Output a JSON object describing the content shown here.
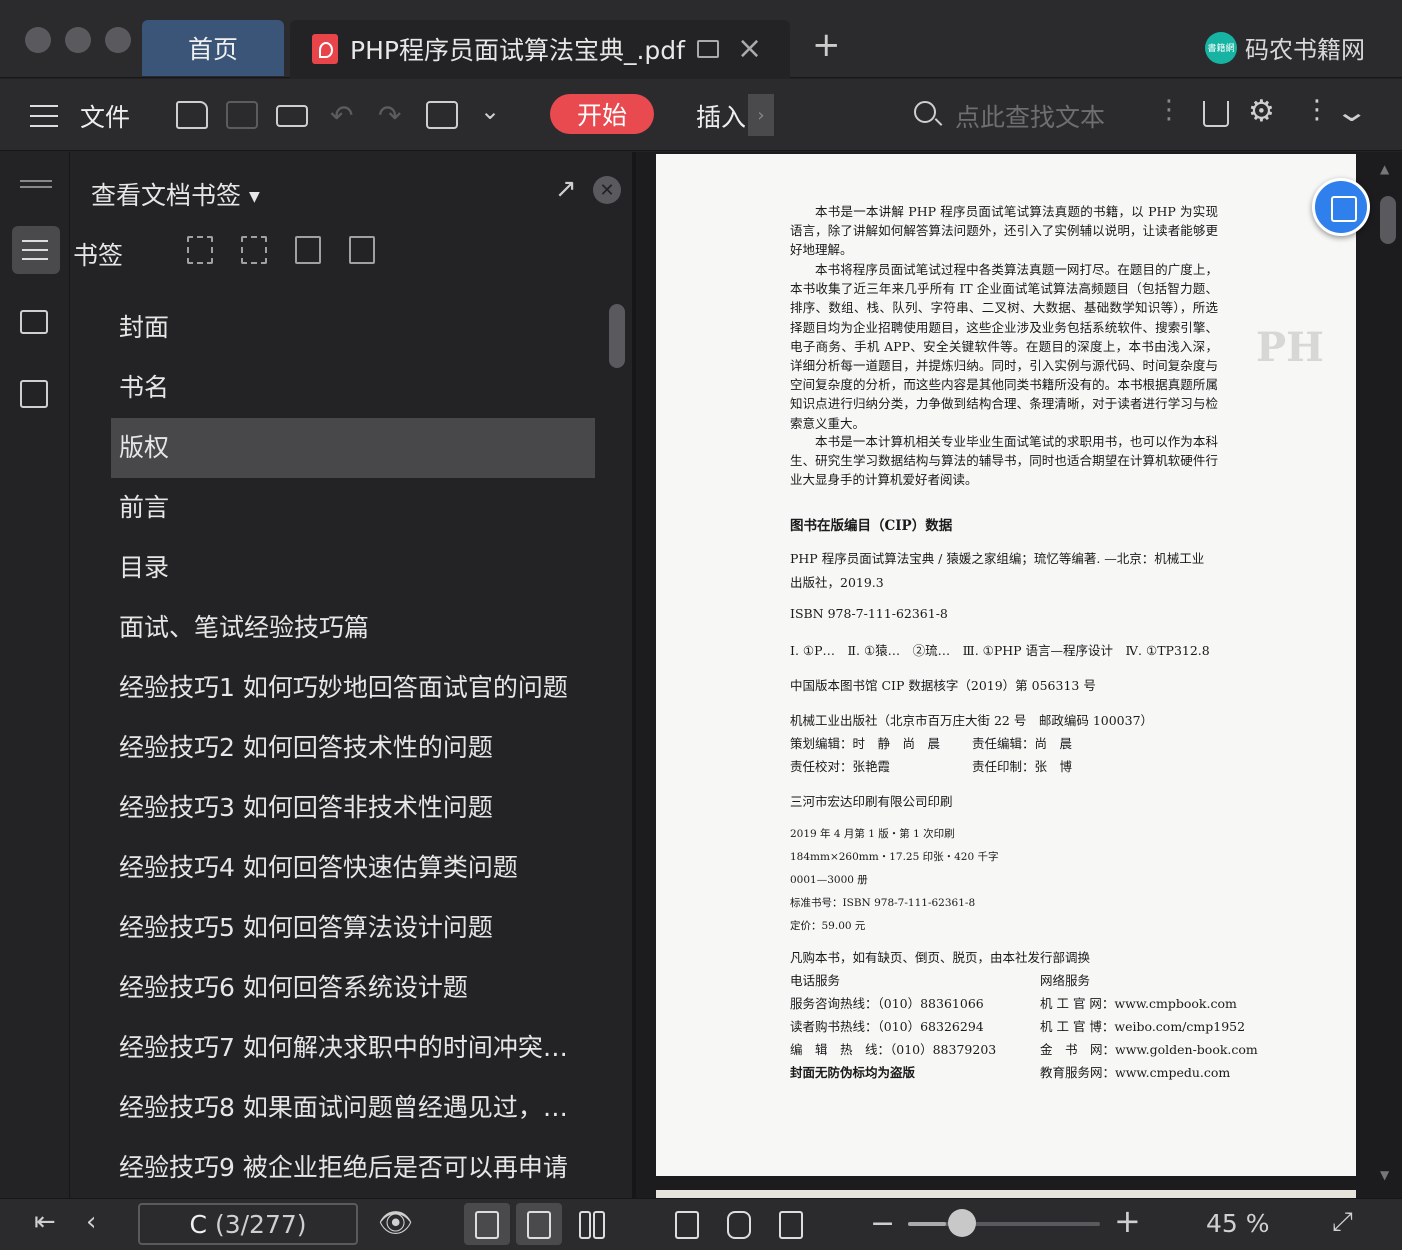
{
  "tabs": {
    "home": "首页",
    "doc": "PHP程序员面试算法宝典_.pdf"
  },
  "brand": {
    "name": "码农书籍网",
    "logo_text": "書籍網"
  },
  "toolbar": {
    "file": "文件",
    "start": "开始",
    "insert": "插入",
    "search_placeholder": "点此查找文本"
  },
  "panel": {
    "title": "查看文档书签",
    "bookmarks_label": "书签",
    "items": [
      "封面",
      "书名",
      "版权",
      "前言",
      "目录",
      "面试、笔试经验技巧篇",
      "经验技巧1 如何巧妙地回答面试官的问题",
      "经验技巧2 如何回答技术性的问题",
      "经验技巧3 如何回答非技术性问题",
      "经验技巧4 如何回答快速估算类问题",
      "经验技巧5 如何回答算法设计问题",
      "经验技巧6 如何回答系统设计题",
      "经验技巧7 如何解决求职中的时间冲突…",
      "经验技巧8 如果面试问题曾经遇见过，…",
      "经验技巧9 被企业拒绝后是否可以再申请"
    ],
    "selected_index": 2
  },
  "page": {
    "p1": "本书是一本讲解 PHP 程序员面试笔试算法真题的书籍，以 PHP 为实现语言，除了讲解如何解答算法问题外，还引入了实例辅以说明，让读者能够更好地理解。",
    "p2": "本书将程序员面试笔试过程中各类算法真题一网打尽。在题目的广度上，本书收集了近三年来几乎所有 IT 企业面试笔试算法高频题目（包括智力题、排序、数组、栈、队列、字符串、二叉树、大数据、基础数学知识等），所选择题目均为企业招聘使用题目，这些企业涉及业务包括系统软件、搜索引擎、电子商务、手机 APP、安全关键软件等。在题目的深度上，本书由浅入深，详细分析每一道题目，并提炼归纳。同时，引入实例与源代码、时间复杂度与空间复杂度的分析，而这些内容是其他同类书籍所没有的。本书根据真题所属知识点进行归纳分类，力争做到结构合理、条理清晰，对于读者进行学习与检索意义重大。",
    "p3": "本书是一本计算机相关专业毕业生面试笔试的求职用书，也可以作为本科生、研究生学习数据结构与算法的辅导书，同时也适合期望在计算机软硬件行业大显身手的计算机爱好者阅读。",
    "cip_title": "图书在版编目（CIP）数据",
    "cip_1": "PHP 程序员面试算法宝典 / 猿媛之家组编；琉忆等编著. —北京：机械工业",
    "cip_2": "出版社，2019.3",
    "isbn": "ISBN 978-7-111-62361-8",
    "class": "Ⅰ. ①P…　Ⅱ. ①猿…　②琉…　Ⅲ. ①PHP 语言—程序设计　Ⅳ. ①TP312.8",
    "cip_no": "中国版本图书馆 CIP 数据核字（2019）第 056313 号",
    "publisher": "机械工业出版社（北京市百万庄大街 22 号　邮政编码 100037）",
    "editor_plan": "策划编辑：时　静　尚　晨",
    "editor_resp": "责任编辑：尚　晨",
    "proof": "责任校对：张艳霞",
    "print_resp": "责任印制：张　博",
    "printer": "三河市宏达印刷有限公司印刷",
    "edition": "2019 年 4 月第 1 版・第 1 次印刷",
    "format": "184mm×260mm・17.25 印张・420 千字",
    "copies": "0001—3000 册",
    "std_no": "标准书号：ISBN 978-7-111-62361-8",
    "price": "定价：59.00 元",
    "notice": "凡购本书，如有缺页、倒页、脱页，由本社发行部调换",
    "phone_title": "电话服务",
    "net_title": "网络服务",
    "phone_1": "服务咨询热线：（010）88361066",
    "phone_2": "读者购书热线：（010）68326294",
    "phone_3": "编　辑　热　线：（010）88379203",
    "anti": "封面无防伪标均为盗版",
    "net_1": "机 工 官 网：www.cmpbook.com",
    "net_2": "机 工 官 博：weibo.com/cmp1952",
    "net_3": "金　书　网：www.golden-book.com",
    "net_4": "教育服务网：www.cmpedu.com"
  },
  "status": {
    "page_current": "C",
    "page_count": "(3/277)",
    "zoom": "45 %",
    "zoom_fraction": 0.2
  },
  "colors": {
    "accent_start": "#e84a4f",
    "home_tab": "#3a5577",
    "float_button": "#2f80ed",
    "brand_logo": "#17b3a3"
  }
}
